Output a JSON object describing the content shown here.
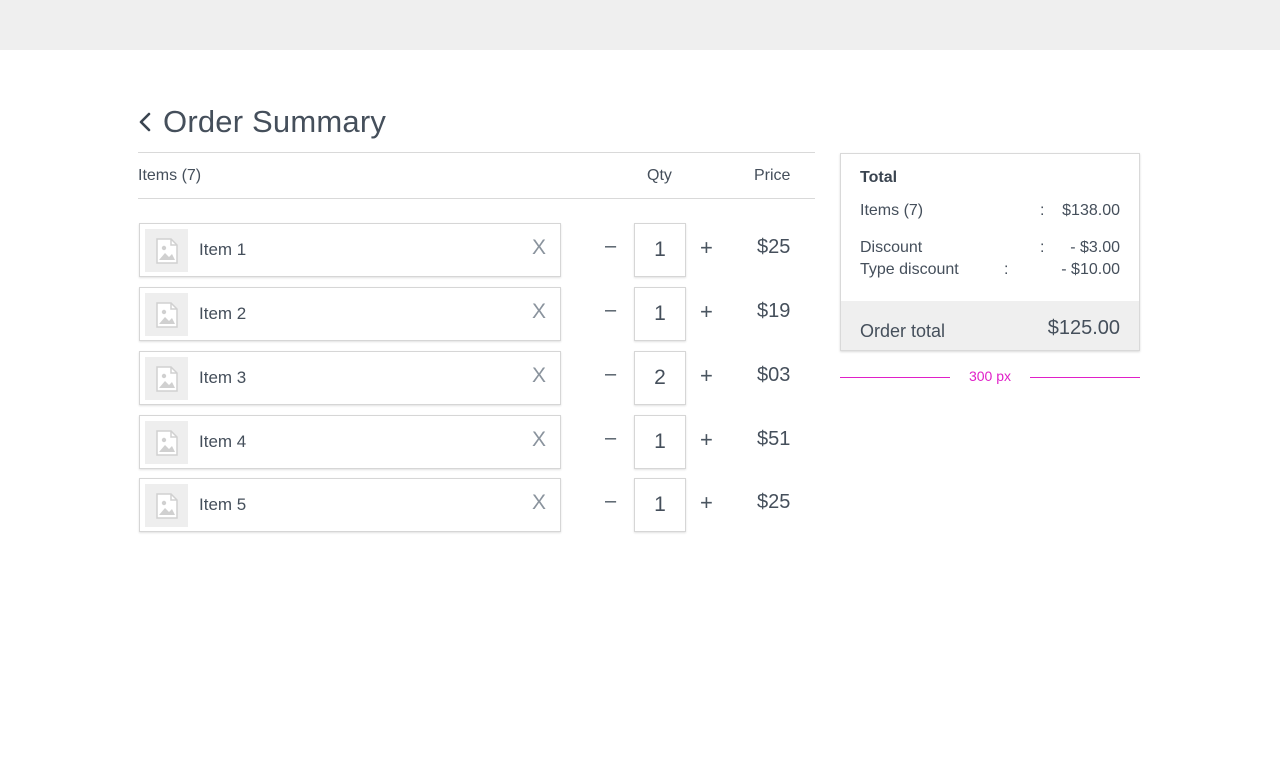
{
  "header": {
    "title": "Order Summary"
  },
  "list": {
    "col_items": "Items (7)",
    "col_qty": "Qty",
    "col_price": "Price",
    "remove_label": "X",
    "minus_label": "–",
    "plus_label": "+"
  },
  "items": [
    {
      "name": "Item 1",
      "qty": "1",
      "price": "$25"
    },
    {
      "name": "Item 2",
      "qty": "1",
      "price": "$19"
    },
    {
      "name": "Item 3",
      "qty": "2",
      "price": "$03"
    },
    {
      "name": "Item 4",
      "qty": "1",
      "price": "$51"
    },
    {
      "name": "Item 5",
      "qty": "1",
      "price": "$25"
    }
  ],
  "summary": {
    "title": "Total",
    "items_label": "Items (7)",
    "items_value": "$138.00",
    "discount_label": "Discount",
    "discount_value": "- $3.00",
    "type_discount_label": "Type discount",
    "type_discount_value": "- $10.00",
    "colon": ":",
    "order_total_label": "Order total",
    "order_total_value": "$125.00"
  },
  "annotation": {
    "width_label": "300 px"
  },
  "colors": {
    "topbar": "#efefef",
    "text": "#454f5b",
    "annotation": "#e020c8"
  },
  "icons": {
    "back": "chevron-left-icon",
    "thumb": "image-placeholder-icon"
  }
}
